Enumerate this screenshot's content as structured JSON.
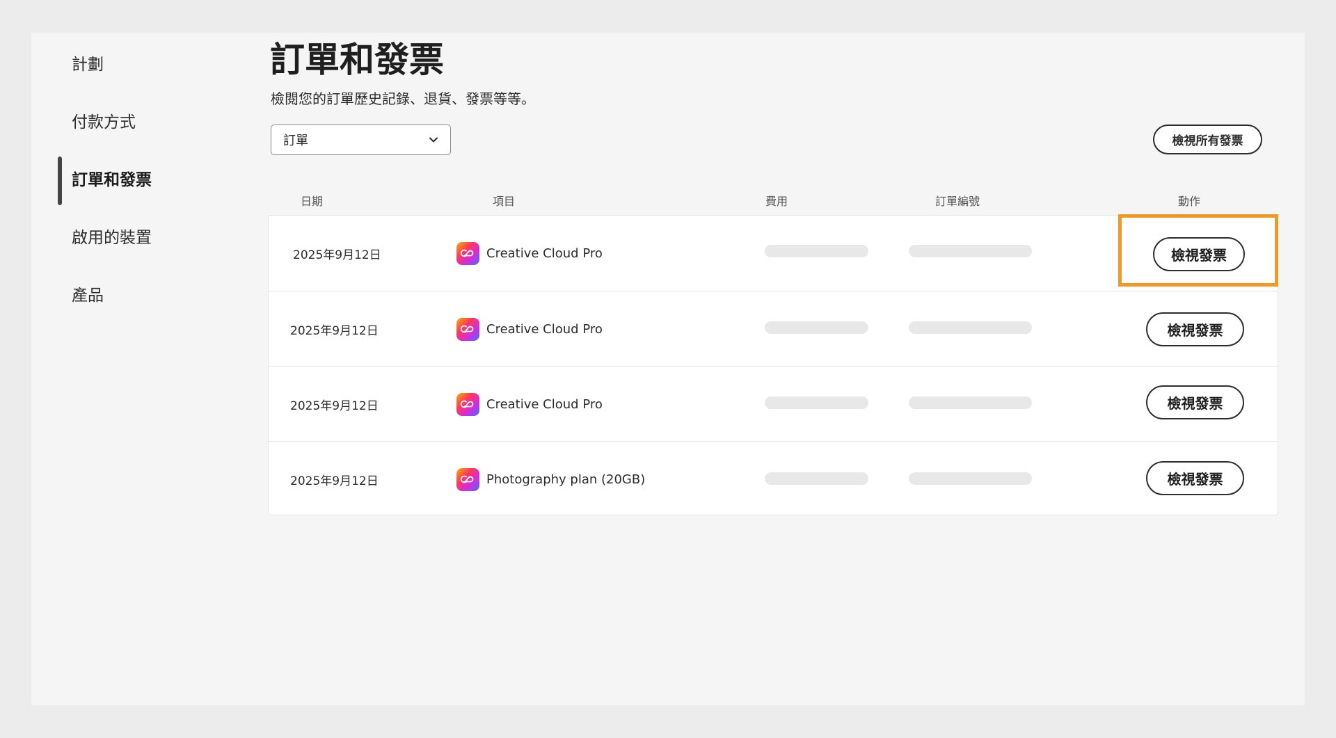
{
  "sidebar": {
    "items": [
      {
        "label": "計劃"
      },
      {
        "label": "付款方式"
      },
      {
        "label": "訂單和發票"
      },
      {
        "label": "啟用的裝置"
      },
      {
        "label": "產品"
      }
    ],
    "active_index": 2
  },
  "main": {
    "title": "訂單和發票",
    "subtitle": "檢閱您的訂單歷史記錄、退貨、發票等等。",
    "filter": {
      "selected": "訂單"
    },
    "view_all_label": "檢視所有發票",
    "columns": [
      "日期",
      "項目",
      "費用",
      "訂單編號",
      "動作"
    ],
    "rows": [
      {
        "date": "2025年9月12日",
        "item": "Creative Cloud Pro",
        "action": "檢視發票"
      },
      {
        "date": "2025年9月12日",
        "item": "Creative Cloud Pro",
        "action": "檢視發票"
      },
      {
        "date": "2025年9月12日",
        "item": "Creative Cloud Pro",
        "action": "檢視發票"
      },
      {
        "date": "2025年9月12日",
        "item": "Photography plan (20GB)",
        "action": "檢視發票"
      }
    ]
  },
  "icons": {
    "product": "creative-cloud-icon",
    "dropdown": "chevron-down-icon"
  },
  "colors": {
    "highlight": "#ee9a2a",
    "background": "#f5f5f5"
  }
}
